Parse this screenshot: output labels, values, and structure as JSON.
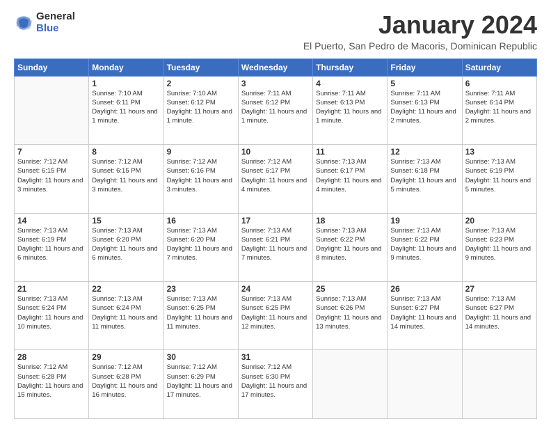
{
  "logo": {
    "general": "General",
    "blue": "Blue"
  },
  "header": {
    "title": "January 2024",
    "subtitle": "El Puerto, San Pedro de Macoris, Dominican Republic"
  },
  "weekdays": [
    "Sunday",
    "Monday",
    "Tuesday",
    "Wednesday",
    "Thursday",
    "Friday",
    "Saturday"
  ],
  "weeks": [
    [
      {
        "day": "",
        "empty": true
      },
      {
        "day": "1",
        "sunrise": "7:10 AM",
        "sunset": "6:11 PM",
        "daylight": "11 hours and 1 minute."
      },
      {
        "day": "2",
        "sunrise": "7:10 AM",
        "sunset": "6:12 PM",
        "daylight": "11 hours and 1 minute."
      },
      {
        "day": "3",
        "sunrise": "7:11 AM",
        "sunset": "6:12 PM",
        "daylight": "11 hours and 1 minute."
      },
      {
        "day": "4",
        "sunrise": "7:11 AM",
        "sunset": "6:13 PM",
        "daylight": "11 hours and 1 minute."
      },
      {
        "day": "5",
        "sunrise": "7:11 AM",
        "sunset": "6:13 PM",
        "daylight": "11 hours and 2 minutes."
      },
      {
        "day": "6",
        "sunrise": "7:11 AM",
        "sunset": "6:14 PM",
        "daylight": "11 hours and 2 minutes."
      }
    ],
    [
      {
        "day": "7",
        "sunrise": "7:12 AM",
        "sunset": "6:15 PM",
        "daylight": "11 hours and 3 minutes."
      },
      {
        "day": "8",
        "sunrise": "7:12 AM",
        "sunset": "6:15 PM",
        "daylight": "11 hours and 3 minutes."
      },
      {
        "day": "9",
        "sunrise": "7:12 AM",
        "sunset": "6:16 PM",
        "daylight": "11 hours and 3 minutes."
      },
      {
        "day": "10",
        "sunrise": "7:12 AM",
        "sunset": "6:17 PM",
        "daylight": "11 hours and 4 minutes."
      },
      {
        "day": "11",
        "sunrise": "7:13 AM",
        "sunset": "6:17 PM",
        "daylight": "11 hours and 4 minutes."
      },
      {
        "day": "12",
        "sunrise": "7:13 AM",
        "sunset": "6:18 PM",
        "daylight": "11 hours and 5 minutes."
      },
      {
        "day": "13",
        "sunrise": "7:13 AM",
        "sunset": "6:19 PM",
        "daylight": "11 hours and 5 minutes."
      }
    ],
    [
      {
        "day": "14",
        "sunrise": "7:13 AM",
        "sunset": "6:19 PM",
        "daylight": "11 hours and 6 minutes."
      },
      {
        "day": "15",
        "sunrise": "7:13 AM",
        "sunset": "6:20 PM",
        "daylight": "11 hours and 6 minutes."
      },
      {
        "day": "16",
        "sunrise": "7:13 AM",
        "sunset": "6:20 PM",
        "daylight": "11 hours and 7 minutes."
      },
      {
        "day": "17",
        "sunrise": "7:13 AM",
        "sunset": "6:21 PM",
        "daylight": "11 hours and 7 minutes."
      },
      {
        "day": "18",
        "sunrise": "7:13 AM",
        "sunset": "6:22 PM",
        "daylight": "11 hours and 8 minutes."
      },
      {
        "day": "19",
        "sunrise": "7:13 AM",
        "sunset": "6:22 PM",
        "daylight": "11 hours and 9 minutes."
      },
      {
        "day": "20",
        "sunrise": "7:13 AM",
        "sunset": "6:23 PM",
        "daylight": "11 hours and 9 minutes."
      }
    ],
    [
      {
        "day": "21",
        "sunrise": "7:13 AM",
        "sunset": "6:24 PM",
        "daylight": "11 hours and 10 minutes."
      },
      {
        "day": "22",
        "sunrise": "7:13 AM",
        "sunset": "6:24 PM",
        "daylight": "11 hours and 11 minutes."
      },
      {
        "day": "23",
        "sunrise": "7:13 AM",
        "sunset": "6:25 PM",
        "daylight": "11 hours and 11 minutes."
      },
      {
        "day": "24",
        "sunrise": "7:13 AM",
        "sunset": "6:25 PM",
        "daylight": "11 hours and 12 minutes."
      },
      {
        "day": "25",
        "sunrise": "7:13 AM",
        "sunset": "6:26 PM",
        "daylight": "11 hours and 13 minutes."
      },
      {
        "day": "26",
        "sunrise": "7:13 AM",
        "sunset": "6:27 PM",
        "daylight": "11 hours and 14 minutes."
      },
      {
        "day": "27",
        "sunrise": "7:13 AM",
        "sunset": "6:27 PM",
        "daylight": "11 hours and 14 minutes."
      }
    ],
    [
      {
        "day": "28",
        "sunrise": "7:12 AM",
        "sunset": "6:28 PM",
        "daylight": "11 hours and 15 minutes."
      },
      {
        "day": "29",
        "sunrise": "7:12 AM",
        "sunset": "6:28 PM",
        "daylight": "11 hours and 16 minutes."
      },
      {
        "day": "30",
        "sunrise": "7:12 AM",
        "sunset": "6:29 PM",
        "daylight": "11 hours and 17 minutes."
      },
      {
        "day": "31",
        "sunrise": "7:12 AM",
        "sunset": "6:30 PM",
        "daylight": "11 hours and 17 minutes."
      },
      {
        "day": "",
        "empty": true
      },
      {
        "day": "",
        "empty": true
      },
      {
        "day": "",
        "empty": true
      }
    ]
  ]
}
